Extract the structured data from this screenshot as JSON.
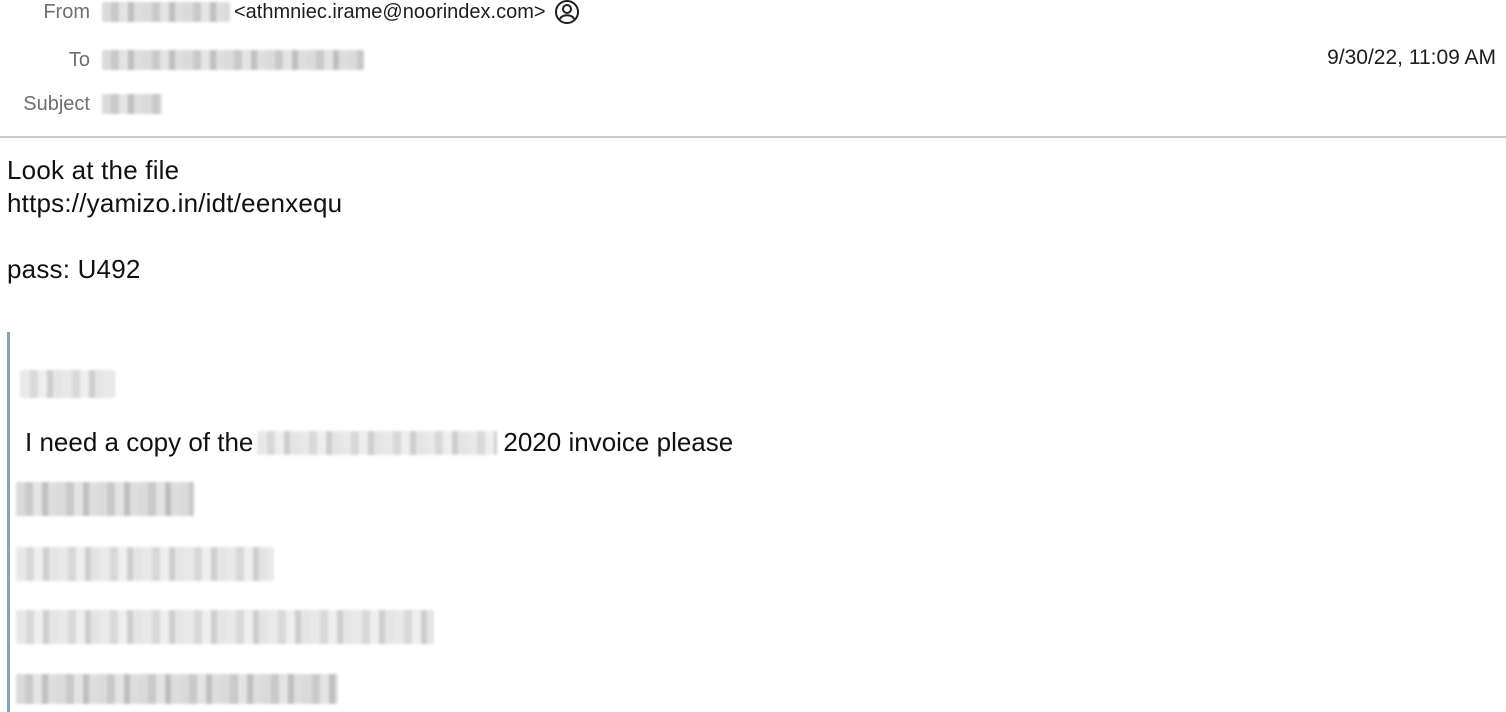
{
  "header": {
    "from_label": "From",
    "from_email": "<athmniec.irame@noorindex.com>",
    "to_label": "To",
    "subject_label": "Subject",
    "date": "9/30/22, 11:09 AM",
    "contact_icon": "person-circle-icon"
  },
  "body": {
    "line1": "Look at the file",
    "line2": "https://yamizo.in/idt/eenxequ",
    "line3": "pass: U492"
  },
  "quote": {
    "text_before": "I need a copy of the",
    "text_after": "2020 invoice please",
    "border_color": "#7ea6bf"
  }
}
